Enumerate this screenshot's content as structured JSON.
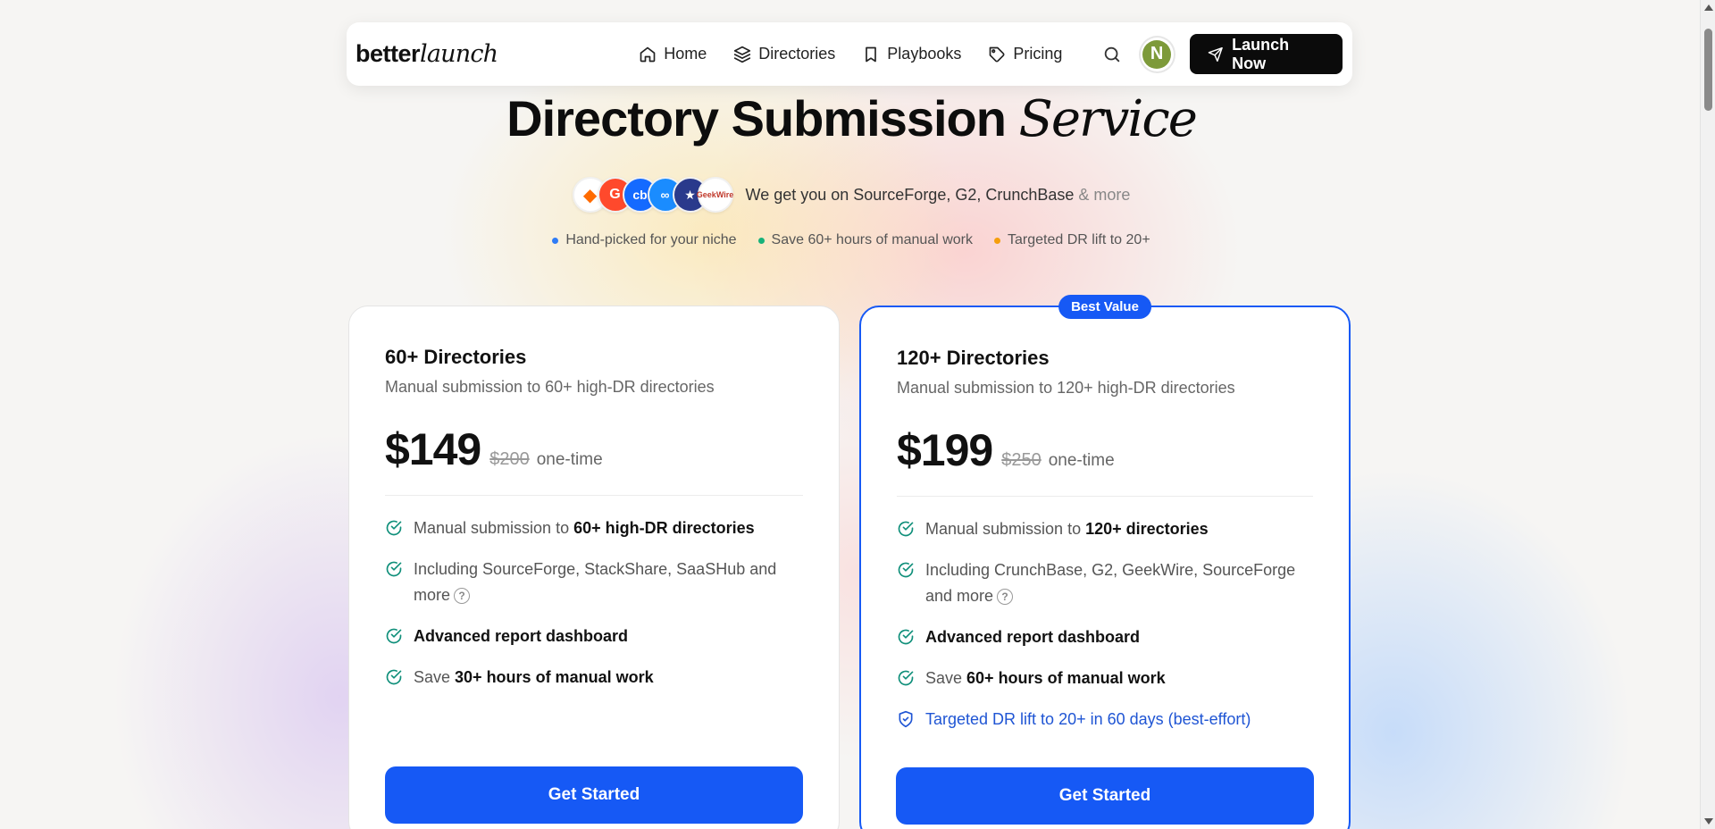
{
  "nav": {
    "logo_main": "better",
    "logo_italic": "launch",
    "links": [
      {
        "label": "Home",
        "icon": "home-icon"
      },
      {
        "label": "Directories",
        "icon": "layers-icon"
      },
      {
        "label": "Playbooks",
        "icon": "bookmark-icon"
      },
      {
        "label": "Pricing",
        "icon": "tag-icon"
      }
    ],
    "avatar_initial": "N",
    "launch_label": "Launch Now"
  },
  "hero": {
    "title_main": "Directory Submission",
    "title_serif": "Service",
    "logos_text": "We get you on SourceForge, G2, CrunchBase",
    "logos_more": "& more",
    "logo_marks": {
      "cb": "cb",
      "g2": "G",
      "oo": "∞",
      "sh": "★",
      "gw1": "Geek",
      "gw2": "Wire"
    },
    "bullets": [
      {
        "text": "Hand-picked for your niche",
        "color": "#2f7cf6"
      },
      {
        "text": "Save 60+ hours of manual work",
        "color": "#16b27a"
      },
      {
        "text": "Targeted DR lift to 20+",
        "color": "#f59e0b"
      }
    ]
  },
  "plans": [
    {
      "title": "60+ Directories",
      "subtitle": "Manual submission to 60+ high-DR directories",
      "price": "$149",
      "old_price": "$200",
      "period": "one-time",
      "f1_pre": "Manual submission to ",
      "f1_bold": "60+ high-DR directories",
      "f2": "Including SourceForge, StackShare, SaaSHub and more",
      "f3": "Advanced report dashboard",
      "f4_pre": "Save ",
      "f4_bold": "30+ hours of manual work",
      "cta": "Get Started"
    },
    {
      "badge": "Best Value",
      "title": "120+ Directories",
      "subtitle": "Manual submission to 120+ high-DR directories",
      "price": "$199",
      "old_price": "$250",
      "period": "one-time",
      "f1_pre": "Manual submission to ",
      "f1_bold": "120+ directories",
      "f2": "Including CrunchBase, G2, GeekWire, SourceForge and more",
      "f3": "Advanced report dashboard",
      "f4_pre": "Save ",
      "f4_bold": "60+ hours of manual work",
      "f5": "Targeted DR lift to 20+ in 60 days (best-effort)",
      "cta": "Get Started"
    }
  ],
  "colors": {
    "accent": "#1659f5",
    "check": "#0f8f7a"
  }
}
